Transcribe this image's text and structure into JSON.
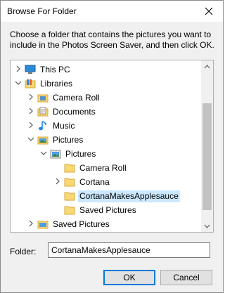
{
  "dialog": {
    "title": "Browse For Folder",
    "instructions": "Choose a folder that contains the pictures you want to include in the Photos Screen Saver, and then click OK."
  },
  "tree": {
    "items": [
      {
        "label": "This PC",
        "icon": "pc-icon",
        "expander": "chevron-right-icon"
      },
      {
        "label": "Libraries",
        "icon": "library-icon",
        "expander": "chevron-down-icon"
      },
      {
        "label": "Camera Roll",
        "icon": "camera-roll-library-icon",
        "expander": "chevron-right-icon"
      },
      {
        "label": "Documents",
        "icon": "documents-library-icon",
        "expander": "chevron-right-icon"
      },
      {
        "label": "Music",
        "icon": "music-library-icon",
        "expander": "chevron-right-icon"
      },
      {
        "label": "Pictures",
        "icon": "pictures-library-icon",
        "expander": "chevron-down-icon"
      },
      {
        "label": "Pictures",
        "icon": "pictures-folder-icon",
        "expander": "chevron-down-icon"
      },
      {
        "label": "Camera Roll",
        "icon": "folder-icon",
        "expander": ""
      },
      {
        "label": "Cortana",
        "icon": "folder-icon",
        "expander": "chevron-right-icon"
      },
      {
        "label": "CortanaMakesApplesauce",
        "icon": "folder-icon",
        "expander": "",
        "selected": true
      },
      {
        "label": "Saved Pictures",
        "icon": "folder-icon",
        "expander": ""
      },
      {
        "label": "Saved Pictures",
        "icon": "saved-pictures-library-icon",
        "expander": "chevron-right-icon"
      }
    ]
  },
  "folder": {
    "label": "Folder:",
    "value": "CortanaMakesApplesauce"
  },
  "buttons": {
    "ok": "OK",
    "cancel": "Cancel"
  },
  "colors": {
    "selection": "#cce8ff",
    "folder": "#f8d775",
    "accent": "#0078d7"
  }
}
